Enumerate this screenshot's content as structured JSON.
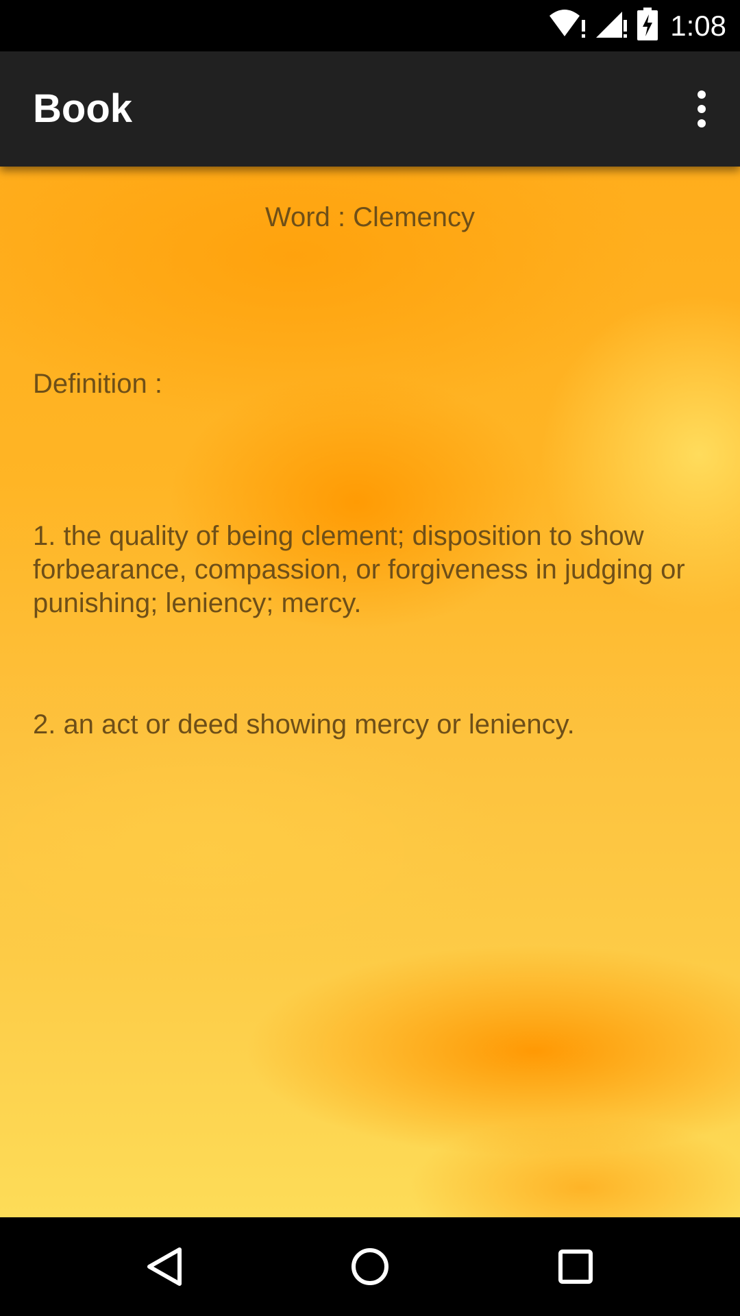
{
  "status_bar": {
    "time": "1:08",
    "icons": [
      "wifi-alert-icon",
      "signal-alert-icon",
      "battery-charging-icon"
    ]
  },
  "app_bar": {
    "title": "Book",
    "overflow_icon": "more-vert-icon"
  },
  "content": {
    "word": "Word : Clemency",
    "definition_label": "Definition :",
    "definitions": [
      "1. the quality of being clement; disposition to show forbearance, compassion, or forgiveness in judging or punishing; leniency; mercy.",
      "2. an act or deed showing mercy or leniency."
    ],
    "text_color": "#6e4f18"
  },
  "nav_bar": {
    "buttons": [
      "back-icon",
      "home-icon",
      "recents-icon"
    ]
  },
  "colors": {
    "status_bar": "#000000",
    "app_bar": "#212121",
    "background_orange": "#ffad1c",
    "background_yellow": "#fddc58"
  }
}
